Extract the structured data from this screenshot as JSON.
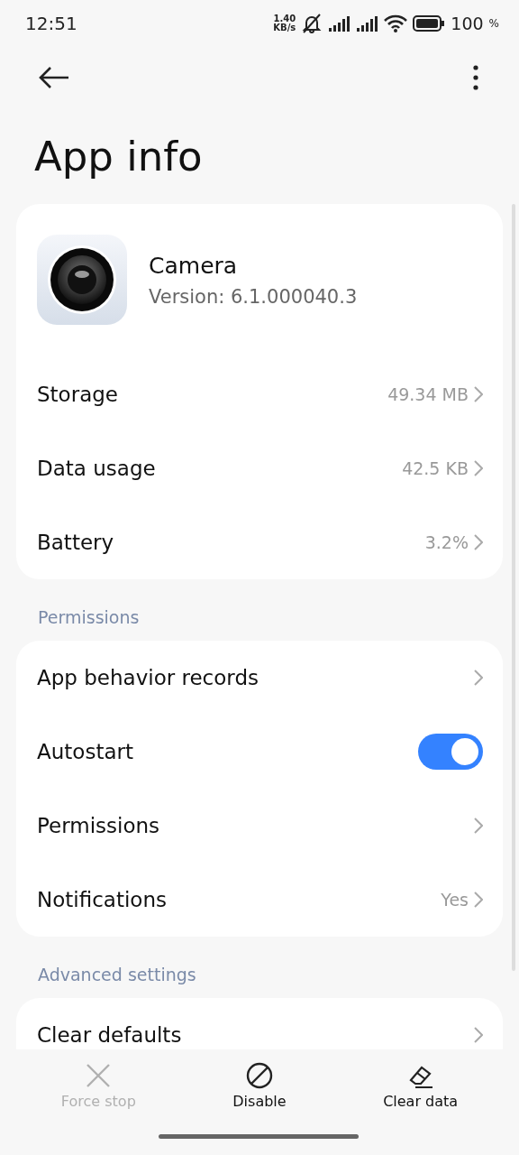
{
  "status_bar": {
    "time": "12:51",
    "net_speed": "1.40",
    "net_unit": "KB/s",
    "battery": "100",
    "battery_unit": "%"
  },
  "title": "App info",
  "app": {
    "name": "Camera",
    "version": "Version: 6.1.000040.3"
  },
  "sections": [
    {
      "rows": [
        {
          "kind": "link",
          "label": "Storage",
          "value": "49.34 MB"
        },
        {
          "kind": "link",
          "label": "Data usage",
          "value": "42.5 KB"
        },
        {
          "kind": "link",
          "label": "Battery",
          "value": "3.2%"
        }
      ]
    },
    {
      "header": "Permissions",
      "rows": [
        {
          "kind": "link",
          "label": "App behavior records"
        },
        {
          "kind": "toggle",
          "label": "Autostart",
          "on": true
        },
        {
          "kind": "link",
          "label": "Permissions"
        },
        {
          "kind": "link",
          "label": "Notifications",
          "value": "Yes"
        }
      ]
    },
    {
      "header": "Advanced settings",
      "rows": [
        {
          "kind": "link",
          "label": "Clear defaults"
        }
      ]
    }
  ],
  "actions": [
    {
      "kind": "force_stop",
      "label": "Force stop",
      "disabled": true
    },
    {
      "kind": "disable",
      "label": "Disable",
      "disabled": false
    },
    {
      "kind": "clear",
      "label": "Clear data",
      "disabled": false
    }
  ]
}
